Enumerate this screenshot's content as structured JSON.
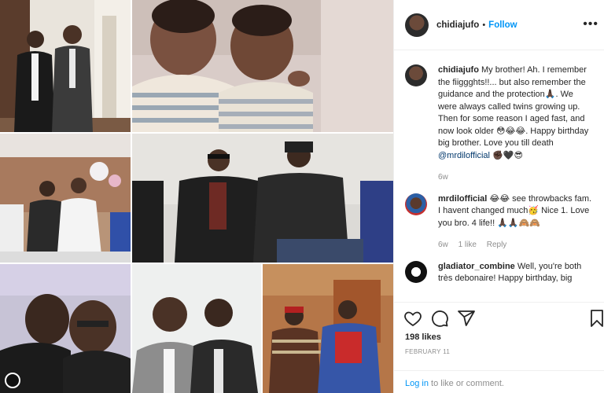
{
  "header": {
    "username": "chidiajufo",
    "separator": "•",
    "follow_label": "Follow",
    "more_icon": "more-horizontal-icon"
  },
  "caption": {
    "username": "chidiajufo",
    "text_1": "My brother! Ah. I remember the fiiggghts!!... but also remember the guidance and the protection",
    "emoji_1": "🙏🏿",
    "text_2": ". We were always called twins growing up. Then for some reason I aged fast, and now look older ",
    "emoji_2": "😳😂😂",
    "text_3": ". Happy birthday big brother. Love you till death ",
    "mention": "@mrdilofficial",
    "emoji_3": "✊🏿🖤😎",
    "age": "6w"
  },
  "comments": [
    {
      "username": "mrdilofficial",
      "text": "😂😂 see throwbacks fam. I havent changed much🥳 Nice 1. Love you bro. 4 life!! 🙏🏿🙏🏿🙈🙈",
      "age": "6w",
      "likes": "1 like",
      "reply_label": "Reply"
    },
    {
      "username": "gladiator_combine",
      "text": "Well, you're both très debonaire! Happy birthday, big"
    }
  ],
  "actions": {
    "like_icon": "heart-icon",
    "comment_icon": "comment-icon",
    "share_icon": "share-icon",
    "save_icon": "bookmark-icon",
    "likes_count": "198 likes",
    "date": "FEBRUARY 11"
  },
  "login": {
    "link": "Log in",
    "text": " to like or comment."
  },
  "colors": {
    "accent": "#0095f6",
    "mention": "#00376b",
    "meta": "#8e8e8e"
  }
}
